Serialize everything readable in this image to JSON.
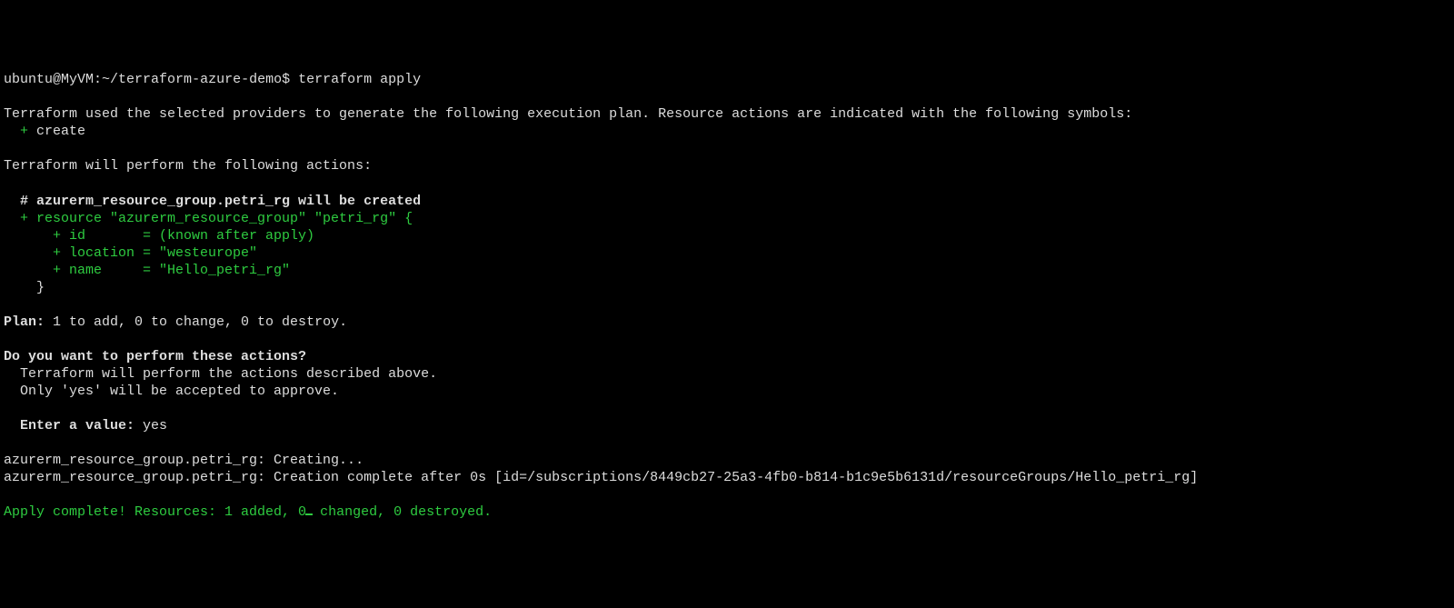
{
  "prompt": {
    "user_host": "ubuntu@MyVM",
    "path": "~/terraform-azure-demo",
    "symbol": "$",
    "command": "terraform apply"
  },
  "intro1": "Terraform used the selected providers to generate the following execution plan. Resource actions are indicated with the following symbols:",
  "create_symbol": "  + ",
  "create_word": "create",
  "intro2": "Terraform will perform the following actions:",
  "comment_line": "  # azurerm_resource_group.petri_rg will be created",
  "resource_open": "  + resource \"azurerm_resource_group\" \"petri_rg\" {",
  "attr_id": "      + id       = (known after apply)",
  "attr_location": "      + location = \"westeurope\"",
  "attr_name": "      + name     = \"Hello_petri_rg\"",
  "resource_close": "    }",
  "plan_label": "Plan:",
  "plan_rest": " 1 to add, 0 to change, 0 to destroy.",
  "confirm_q": "Do you want to perform these actions?",
  "confirm_l1": "  Terraform will perform the actions described above.",
  "confirm_l2": "  Only 'yes' will be accepted to approve.",
  "enter_label": "  Enter a value: ",
  "enter_value": "yes",
  "creating": "azurerm_resource_group.petri_rg: Creating...",
  "created": "azurerm_resource_group.petri_rg: Creation complete after 0s [id=/subscriptions/8449cb27-25a3-4fb0-b814-b1c9e5b6131d/resourceGroups/Hello_petri_rg]",
  "final_a": "Apply complete! Resources: 1 added, 0",
  "final_b": " changed, 0 destroyed."
}
